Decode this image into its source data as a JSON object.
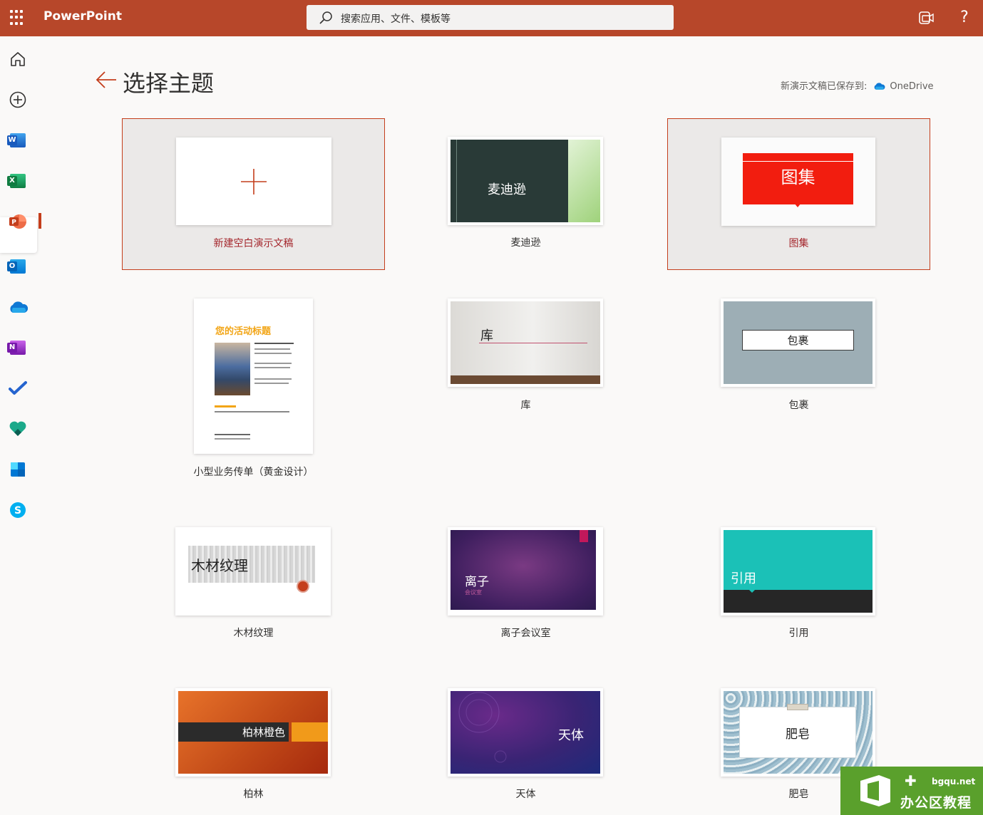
{
  "app": {
    "name": "PowerPoint"
  },
  "search": {
    "placeholder": "搜索应用、文件、模板等"
  },
  "header": {
    "help": "?"
  },
  "page": {
    "title": "选择主题",
    "saved_label": "新演示文稿已保存到:",
    "saved_location": "OneDrive"
  },
  "themes": [
    {
      "name": "新建空白演示文稿",
      "selected": true
    },
    {
      "name": "麦迪逊",
      "thumb_text": "麦迪逊"
    },
    {
      "name": "图集",
      "thumb_text": "图集",
      "selected": true
    },
    {
      "name": "小型业务传单（黄金设计）",
      "thumb_text": "您的活动标题"
    },
    {
      "name": "库",
      "thumb_text": "库"
    },
    {
      "name": "包裹",
      "thumb_text": "包裹"
    },
    {
      "name": "木材纹理",
      "thumb_text": "木材纹理"
    },
    {
      "name": "离子会议室",
      "thumb_text": "离子",
      "thumb_sub": "会议室"
    },
    {
      "name": "引用",
      "thumb_text": "引用"
    },
    {
      "name": "柏林",
      "thumb_text": "柏林橙色"
    },
    {
      "name": "天体",
      "thumb_text": "天体"
    },
    {
      "name": "肥皂",
      "thumb_text": "肥皂"
    }
  ],
  "watermark": {
    "url": "bgqu.net",
    "name": "办公区教程"
  },
  "colors": {
    "brand": "#b7472a",
    "accent": "#c43e1c"
  },
  "rail_icons": [
    "home-icon",
    "create-icon",
    "word-icon",
    "excel-icon",
    "powerpoint-icon",
    "outlook-icon",
    "onedrive-icon",
    "onenote-icon",
    "todo-icon",
    "family-safety-icon",
    "calendar-icon",
    "skype-icon"
  ]
}
